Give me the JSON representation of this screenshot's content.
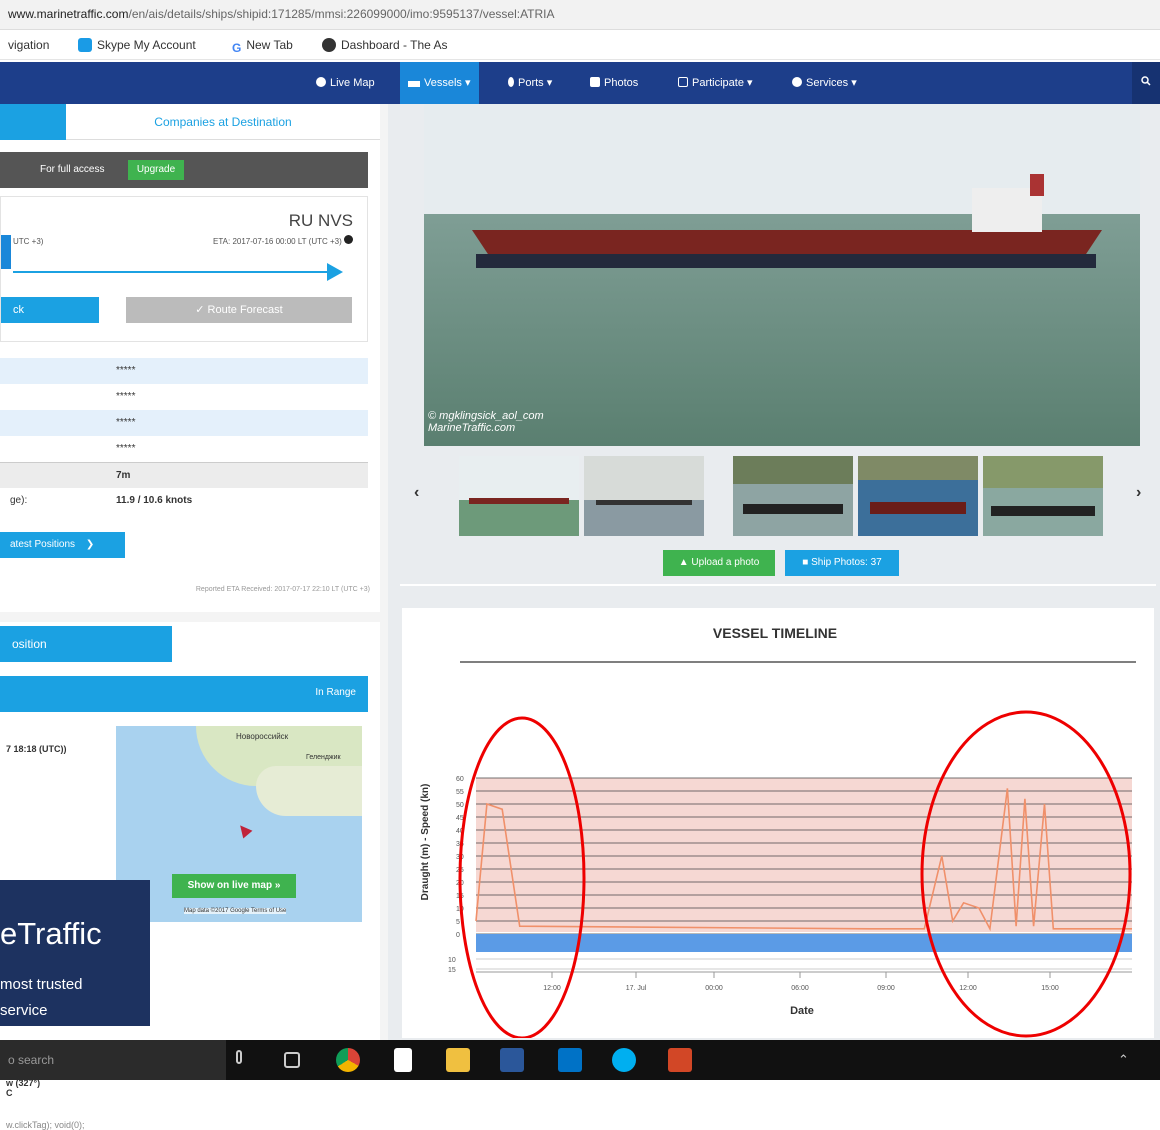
{
  "browser": {
    "url_host": "www.marinetraffic.com",
    "url_path": "/en/ais/details/ships/shipid:171285/mmsi:226099000/imo:9595137/vessel:ATRIA",
    "bookmarks": [
      "vigation",
      "Skype My Account",
      "New Tab",
      "Dashboard - The As"
    ]
  },
  "nav": {
    "items": [
      "Live Map",
      "Vessels ▾",
      "Ports ▾",
      "Photos",
      "Participate ▾",
      "Services ▾"
    ],
    "search_icon": "search-icon"
  },
  "left": {
    "tab_inactive": "Companies at Destination",
    "access_text": "For full access",
    "upgrade_label": "Upgrade",
    "dest_code": "RU NVS",
    "utc_left": "UTC +3)",
    "eta_text": "ETA: 2017-07-16 00:00 LT (UTC +3)",
    "track_label": "ck",
    "route_forecast_label": "Route Forecast",
    "masked_rows": [
      "*****",
      "*****",
      "*****",
      "*****"
    ],
    "draught_value": "7m",
    "speed_label": "ge):",
    "speed_value": "11.9 / 10.6 knots",
    "latest_positions_label": "atest Positions",
    "reported_eta": "Reported ETA Received: 2017-07-17 22:10 LT (UTC +3)",
    "position_tab": "osition",
    "in_range": "In Range",
    "position_time": "7 18:18 (UTC))",
    "map_labels": [
      "Новороссийск",
      "Геленджик"
    ],
    "show_map_label": "Show on live map »",
    "map_attrib": "Map data ©2017 Google  Terms of Use",
    "ad_title": "eTraffic",
    "ad_line1": "most trusted",
    "ad_line2": "service",
    "course": "w (327°)",
    "course2": "C",
    "code_line": "w.clickTag); void(0);"
  },
  "right": {
    "watermark1": "© mgklingsick_aol_com",
    "watermark2": "MarineTraffic.com",
    "upload_label": "Upload a photo",
    "ship_photos_label": "Ship Photos: 37"
  },
  "chart_data": {
    "type": "line",
    "title": "VESSEL TIMELINE",
    "xlabel": "Date",
    "ylabel": "Draught (m) - Speed (kn)",
    "x_ticks": [
      "12:00",
      "17. Jul",
      "00:00",
      "06:00",
      "09:00",
      "12:00",
      "15:00"
    ],
    "y_ticks_upper": [
      "60",
      "55",
      "50",
      "45",
      "40",
      "35",
      "30",
      "25",
      "20",
      "15",
      "10",
      "5",
      "0"
    ],
    "y_ticks_lower": [
      "10",
      "15"
    ],
    "series": [
      {
        "name": "Speed",
        "color": "#f0906a",
        "points": [
          [
            0,
            5
          ],
          [
            0.5,
            50
          ],
          [
            1.2,
            48
          ],
          [
            2,
            3
          ],
          [
            18,
            2
          ],
          [
            20.5,
            2
          ],
          [
            21.3,
            30
          ],
          [
            21.8,
            5
          ],
          [
            22.3,
            12
          ],
          [
            23,
            10
          ],
          [
            23.5,
            2
          ],
          [
            24.3,
            56
          ],
          [
            24.7,
            3
          ],
          [
            25.1,
            52
          ],
          [
            25.5,
            3
          ],
          [
            26,
            50
          ],
          [
            26.4,
            2
          ],
          [
            30,
            2
          ]
        ]
      }
    ],
    "band": {
      "name": "Draught",
      "color": "#5b9be6"
    },
    "xlim": [
      0,
      30
    ],
    "ylim": [
      0,
      60
    ],
    "grid": true
  },
  "taskbar": {
    "search_text": "o search",
    "apps": [
      "mic",
      "task-view",
      "chrome",
      "store",
      "explorer",
      "word",
      "outlook",
      "skype",
      "powerpoint"
    ]
  }
}
